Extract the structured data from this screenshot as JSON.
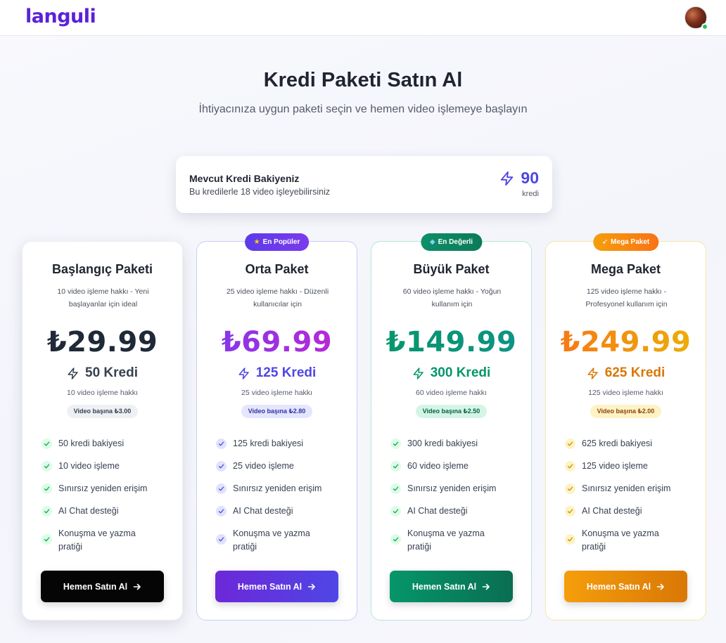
{
  "app": {
    "logo": "languli"
  },
  "header": {
    "title": "Kredi Paketi Satın Al",
    "subtitle": "İhtiyacınıza uygun paketi seçin ve hemen video işlemeye başlayın"
  },
  "balance": {
    "title": "Mevcut Kredi Bakiyeniz",
    "subtitle": "Bu kredilerle 18 video işleyebilirsiniz",
    "value": "90",
    "unit": "kredi"
  },
  "packages": [
    {
      "badge": "",
      "name": "Başlangıç Paketi",
      "description": "10 video işleme hakkı - Yeni başlayanlar için ideal",
      "price": "₺29.99",
      "credits": "50 Kredi",
      "video_count": "10 video işleme hakkı",
      "per_video": "Video başına ₺3.00",
      "features": [
        "50 kredi bakiyesi",
        "10 video işleme",
        "Sınırsız yeniden erişim",
        "AI Chat desteği",
        "Konuşma ve yazma pratiği"
      ],
      "button": "Hemen Satın Al",
      "accent": "#1f2937"
    },
    {
      "badge": "En Popüler",
      "name": "Orta Paket",
      "description": "25 video işleme hakkı - Düzenli kullanıcılar için",
      "price": "₺69.99",
      "credits": "125 Kredi",
      "video_count": "25 video işleme hakkı",
      "per_video": "Video başına ₺2.80",
      "features": [
        "125 kredi bakiyesi",
        "25 video işleme",
        "Sınırsız yeniden erişim",
        "AI Chat desteği",
        "Konuşma ve yazma pratiği"
      ],
      "button": "Hemen Satın Al",
      "accent": "#4f46e5"
    },
    {
      "badge": "En Değerli",
      "name": "Büyük Paket",
      "description": "60 video işleme hakkı - Yoğun kullanım için",
      "price": "₺149.99",
      "credits": "300 Kredi",
      "video_count": "60 video işleme hakkı",
      "per_video": "Video başına ₺2.50",
      "features": [
        "300 kredi bakiyesi",
        "60 video işleme",
        "Sınırsız yeniden erişim",
        "AI Chat desteği",
        "Konuşma ve yazma pratiği"
      ],
      "button": "Hemen Satın Al",
      "accent": "#059669"
    },
    {
      "badge": "Mega Paket",
      "name": "Mega Paket",
      "description": "125 video işleme hakkı - Profesyonel kullanım için",
      "price": "₺249.99",
      "credits": "625 Kredi",
      "video_count": "125 video işleme hakkı",
      "per_video": "Video başına ₺2.00",
      "features": [
        "625 kredi bakiyesi",
        "125 video işleme",
        "Sınırsız yeniden erişim",
        "AI Chat desteği",
        "Konuşma ve yazma pratiği"
      ],
      "button": "Hemen Satın Al",
      "accent": "#d97706"
    }
  ],
  "icons": {
    "bolt": "bolt-icon",
    "check": "check-icon",
    "arrow": "arrow-right-icon",
    "star": "star-icon",
    "gem": "gem-icon",
    "rocket": "rocket-icon"
  }
}
